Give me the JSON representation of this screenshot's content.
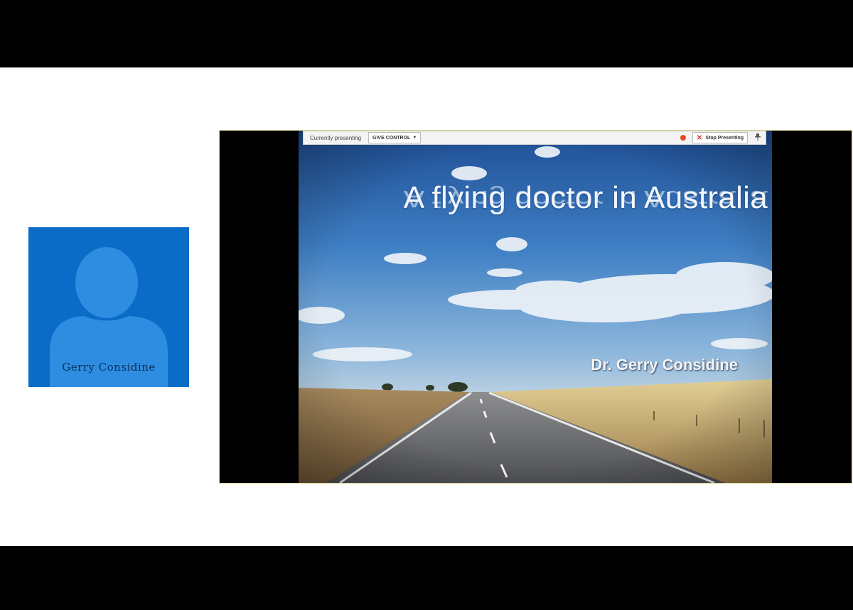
{
  "participant": {
    "name": "Gerry Considine",
    "colors": {
      "tile": "#0a6cc6",
      "silhouette": "#2e8de0"
    }
  },
  "presentation": {
    "toolbar": {
      "currently_presenting": "Currently presenting",
      "give_control": "GIVE CONTROL",
      "stop_presenting": "Stop Presenting",
      "icons": [
        "chevron-down-icon",
        "record-icon",
        "close-icon",
        "pin-icon"
      ]
    },
    "slide": {
      "title": "A flying doctor in Australia",
      "subtitle": "Dr. Gerry Considine"
    }
  }
}
